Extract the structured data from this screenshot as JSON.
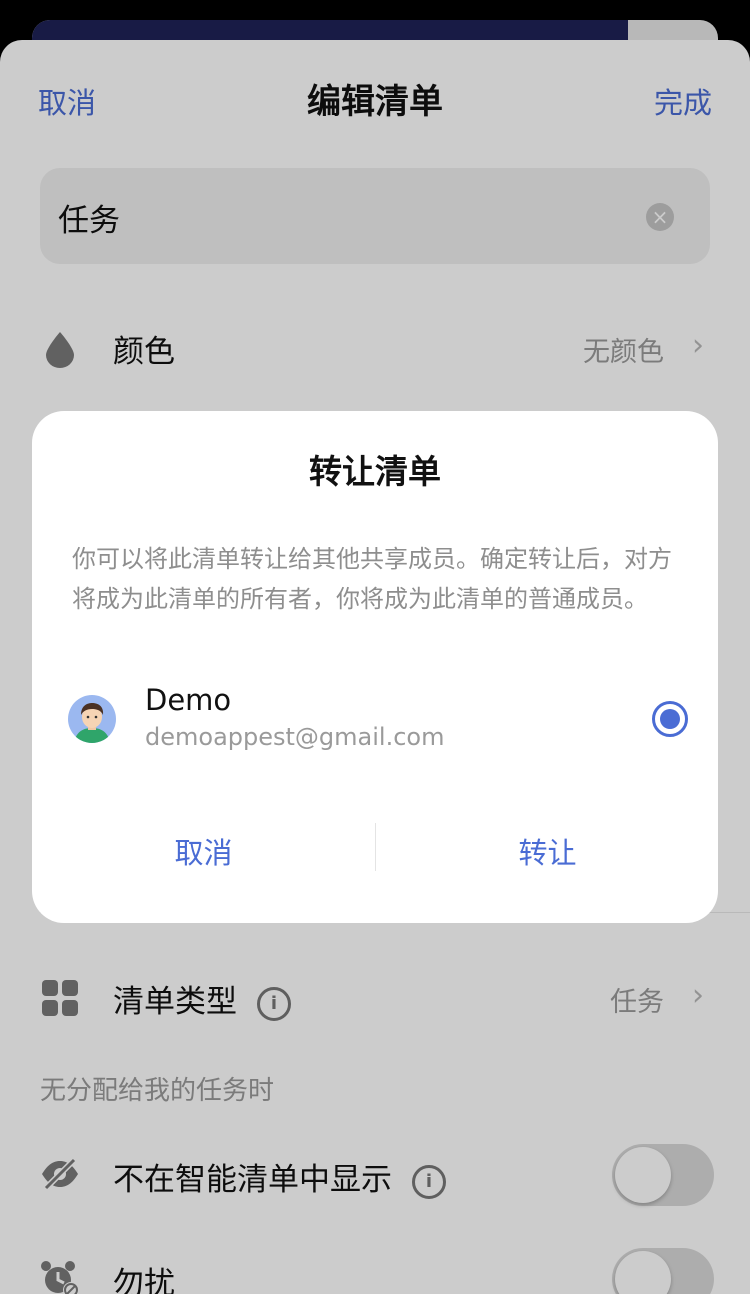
{
  "header": {
    "cancel_label": "取消",
    "title": "编辑清单",
    "done_label": "完成"
  },
  "name_field": {
    "value": "任务"
  },
  "rows": {
    "color": {
      "label": "颜色",
      "value": "无颜色",
      "icon": "droplet-icon"
    },
    "list_type": {
      "label": "清单类型",
      "value": "任务",
      "icon": "grid-icon"
    }
  },
  "section_note": "无分配给我的任务时",
  "toggles": {
    "hide_smart": {
      "label": "不在智能清单中显示",
      "icon": "eye-slash-icon",
      "on": false
    },
    "dnd": {
      "label": "勿扰",
      "icon": "alarm-mute-icon",
      "on": false
    }
  },
  "dialog": {
    "title": "转让清单",
    "description": "你可以将此清单转让给其他共享成员。确定转让后，对方将成为此清单的所有者，你将成为此清单的普通成员。",
    "member": {
      "name": "Demo",
      "email": "demoappest@gmail.com",
      "selected": true
    },
    "cancel_label": "取消",
    "confirm_label": "转让"
  },
  "colors": {
    "accent": "#4a6cd4",
    "navy": "#1f2257"
  }
}
